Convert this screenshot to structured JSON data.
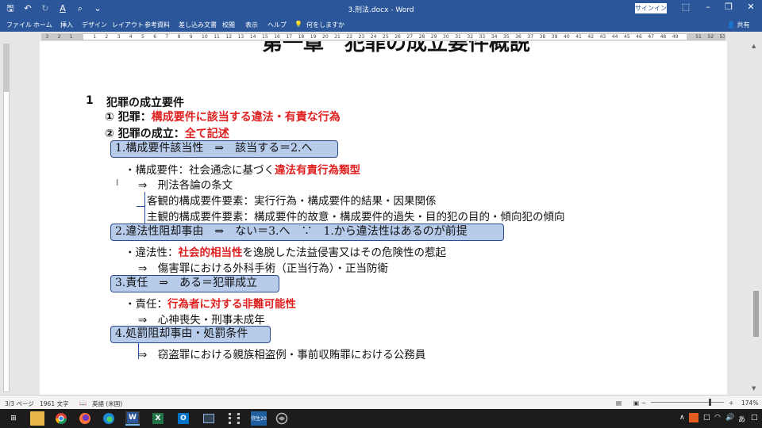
{
  "titlebar": {
    "doc_title": "3.刑法.docx - Word",
    "signin_label": "サインイン",
    "qat_icons": [
      "save-icon",
      "undo-icon",
      "redo-icon",
      "format-painter-icon",
      "search-icon",
      "customize-icon"
    ]
  },
  "tabs": [
    {
      "label": "ファイル"
    },
    {
      "label": "ホーム"
    },
    {
      "label": "挿入"
    },
    {
      "label": "デザイン"
    },
    {
      "label": "レイアウト"
    },
    {
      "label": "参考資料"
    },
    {
      "label": "差し込み文書"
    },
    {
      "label": "校閲"
    },
    {
      "label": "表示"
    },
    {
      "label": "ヘルプ"
    },
    {
      "label": "何をしますか"
    }
  ],
  "share_label": "共有",
  "ruler": {
    "left_numbers": [
      "3",
      "2",
      "1"
    ],
    "numbers": [
      "1",
      "2",
      "3",
      "4",
      "5",
      "6",
      "7",
      "8",
      "9",
      "10",
      "11",
      "12",
      "13",
      "14",
      "15",
      "16",
      "17",
      "18",
      "19",
      "20",
      "21",
      "22",
      "23",
      "24",
      "25",
      "26",
      "27",
      "28",
      "29",
      "30",
      "31",
      "32",
      "33",
      "34",
      "35",
      "36",
      "37",
      "38",
      "39",
      "40",
      "41",
      "42",
      "43",
      "44",
      "45",
      "46",
      "47",
      "48",
      "49"
    ],
    "right_numbers": [
      "51",
      "52",
      "53"
    ]
  },
  "document": {
    "partial_heading": "第一章　犯罪の成立要件概説",
    "section_num": "1",
    "section_title": "犯罪の成立要件",
    "item1_prefix": "① 犯罪：",
    "item1_red": "構成要件に該当する違法・有責な行為",
    "item2_prefix": "② 犯罪の成立：",
    "item2_red": "全て記述",
    "box1": "1.構成要件該当性　⇒　該当する＝2.へ",
    "b1_line1_prefix": "・構成要件：社会通念に基づく",
    "b1_line1_red": "違法有責行為類型",
    "b1_line2": "⇒　刑法各論の条文",
    "b1_line3": "客観的構成要件要素：実行行為・構成要件的結果・因果関係",
    "b1_line4": "主観的構成要件要素：構成要件的故意・構成要件的過失・目的犯の目的・傾向犯の傾向",
    "box2": "2.違法性阻却事由　⇒　ない＝3.へ　∵　1.から違法性はあるのが前提",
    "b2_line1_prefix": "・違法性：",
    "b2_line1_red": "社会的相当性",
    "b2_line1_suffix": "を逸脱した法益侵害又はその危険性の惹起",
    "b2_line2": "⇒　傷害罪における外科手術（正当行為）・正当防衛",
    "box3": "3.責任　⇒　ある＝犯罪成立",
    "b3_line1_prefix": "・責任：",
    "b3_line1_red": "行為者に対する非難可能性",
    "b3_line2": "⇒　心神喪失・刑事未成年",
    "box4": "4.処罰阻却事由・処罰条件",
    "b4_line1": "⇒　窃盗罪における親族相盗例・事前収賄罪における公務員"
  },
  "statusbar": {
    "page": "3/3 ページ",
    "words": "1961 文字",
    "language": "英語 (米国)",
    "zoom": "174%"
  },
  "taskbar": {
    "icons": [
      "windows-start-icon",
      "file-explorer-icon",
      "chrome-icon",
      "firefox-icon",
      "edge-icon",
      "word-icon",
      "excel-icon",
      "outlook-icon",
      "remote-desktop-icon",
      "video-icon",
      "yayoi-icon",
      "app-icon"
    ],
    "yayoi_label": "弥生20",
    "ime_label": "あ"
  },
  "colors": {
    "accent": "#2b579a",
    "box_fill": "#b7cbea",
    "box_border": "#2d4d8a",
    "red_text": "#e02020"
  }
}
